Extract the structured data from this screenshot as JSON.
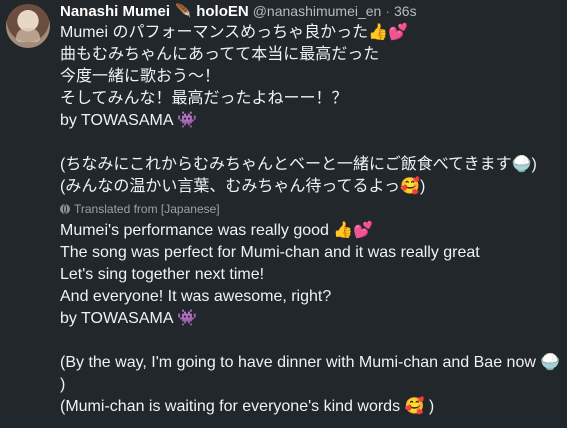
{
  "author": {
    "name": "Nanashi Mumei",
    "affiliation_icon": "feather-icon",
    "affiliation": "holoEN",
    "handle": "@nanashimumei_en",
    "separator": "·",
    "time": "36s"
  },
  "original": {
    "lines": [
      "Mumei のパフォーマンスめっちゃ良かった👍💕",
      "曲もむみちゃんにあってて本当に最高だった",
      "今度一緒に歌おう～！",
      "そしてみんな！最高だったよねーー！？",
      "by TOWASAMA 👾",
      "",
      "(ちなみにこれからむみちゃんとベーと一緒にご飯食べてきます🍚)",
      "(みんなの温かい言葉、むみちゃん待ってるよっ🥰)"
    ]
  },
  "translation": {
    "label": "Translated from [Japanese]",
    "lines": [
      "Mumei's performance was really good 👍💕",
      "The song was perfect for Mumi-chan and it was really great",
      "Let's sing together next time!",
      "And everyone! It was awesome, right?",
      "by TOWASAMA 👾",
      "",
      "(By the way, I'm going to have dinner with Mumi-chan and Bae now 🍚",
      ")",
      "(Mumi-chan is waiting for everyone's kind words 🥰 )"
    ]
  }
}
